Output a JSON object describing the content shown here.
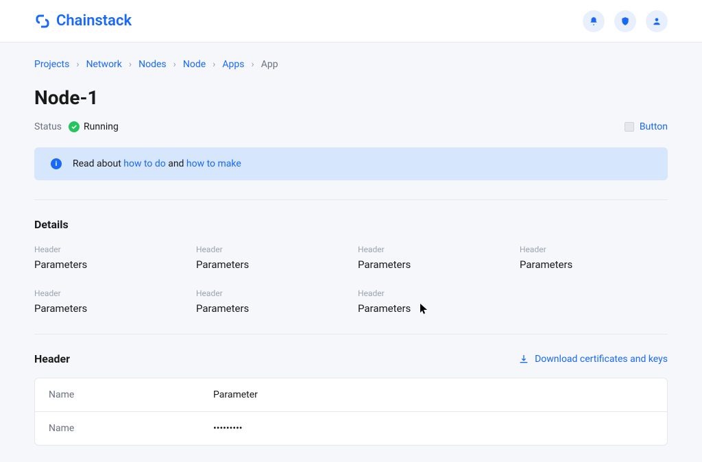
{
  "brand": "Chainstack",
  "header_icons": [
    "bell-icon",
    "shield-icon",
    "user-icon"
  ],
  "breadcrumb": {
    "items": [
      "Projects",
      "Network",
      "Nodes",
      "Node",
      "Apps"
    ],
    "current": "App"
  },
  "page_title": "Node-1",
  "status": {
    "label": "Status",
    "value": "Running"
  },
  "action_button": {
    "label": "Button"
  },
  "info_banner": {
    "prefix": "Read about ",
    "link1": "how to do",
    "middle": " and ",
    "link2": "how to make"
  },
  "details": {
    "title": "Details",
    "items": [
      {
        "header": "Header",
        "value": "Parameters"
      },
      {
        "header": "Header",
        "value": "Parameters"
      },
      {
        "header": "Header",
        "value": "Parameters"
      },
      {
        "header": "Header",
        "value": "Parameters"
      },
      {
        "header": "Header",
        "value": "Parameters"
      },
      {
        "header": "Header",
        "value": "Parameters"
      },
      {
        "header": "Header",
        "value": "Parameters"
      }
    ]
  },
  "second_section": {
    "title": "Header",
    "download_label": "Download certificates and keys",
    "table": {
      "rows": [
        {
          "name": "Name",
          "value": "Parameter"
        },
        {
          "name": "Name",
          "value": "•••••••••"
        }
      ]
    }
  }
}
